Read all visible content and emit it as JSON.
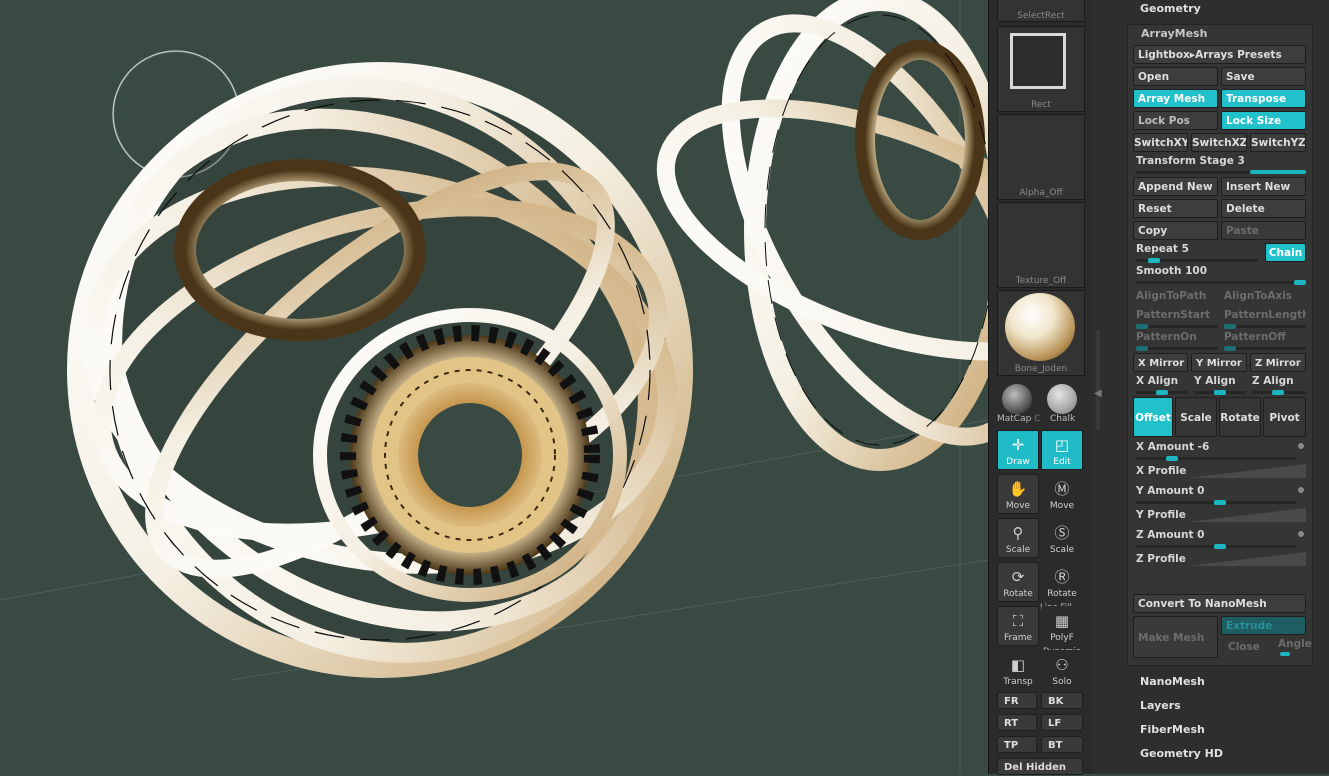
{
  "colors": {
    "accent": "#1fbcc8",
    "viewport_bg": "#394a43",
    "panel_bg": "#2e2e2e"
  },
  "shelf": {
    "top_label": "SelectRect",
    "rect_label": "Rect",
    "alpha_label": "Alpha_Off",
    "texture_label": "Texture_Off",
    "material_label": "Bone_Joden",
    "matcap_label": "MatCap",
    "matcap_suffix": "C",
    "chalk_label": "Chalk",
    "draw": "Draw",
    "edit": "Edit",
    "move1": "Move",
    "move2": "Move",
    "scale1": "Scale",
    "scale2": "Scale",
    "rotate1": "Rotate",
    "rotate2": "Rotate",
    "frame": "Frame",
    "linefill_top": "Line Fill",
    "polyf": "PolyF",
    "transp": "Transp",
    "dynamic_top": "Dynamic",
    "solo": "Solo",
    "fr": "FR",
    "bk": "BK",
    "rt": "RT",
    "lf": "LF",
    "tp": "TP",
    "bt": "BT",
    "del_hidden": "Del Hidden"
  },
  "panel": {
    "geometry": "Geometry",
    "arraymesh_title": "ArrayMesh",
    "lightbox": "Lightbox▸Arrays Presets",
    "open": "Open",
    "save": "Save",
    "array_mesh": "Array Mesh",
    "transpose": "Transpose",
    "lock_pos": "Lock Pos",
    "lock_size": "Lock Size",
    "switch_xy": "SwitchXY",
    "switch_xz": "SwitchXZ",
    "switch_yz": "SwitchYZ",
    "transform_stage": "Transform Stage 3",
    "append_new": "Append New",
    "insert_new": "Insert New",
    "reset": "Reset",
    "delete": "Delete",
    "copy": "Copy",
    "paste": "Paste",
    "repeat": "Repeat 5",
    "chain": "Chain",
    "smooth": "Smooth 100",
    "align_to_path": "AlignToPath",
    "align_to_axis": "AlignToAxis",
    "pattern_start": "PatternStart",
    "pattern_length": "PatternLength",
    "pattern_on": "PatternOn",
    "pattern_off": "PatternOff",
    "x_mirror": "X Mirror",
    "y_mirror": "Y Mirror",
    "z_mirror": "Z Mirror",
    "x_align": "X Align",
    "y_align": "Y Align",
    "z_align": "Z Align",
    "offset": "Offset",
    "scale": "Scale",
    "rotate": "Rotate",
    "pivot": "Pivot",
    "x_amount": "X Amount -6",
    "x_profile": "X Profile",
    "y_amount": "Y Amount 0",
    "y_profile": "Y Profile",
    "z_amount": "Z Amount 0",
    "z_profile": "Z Profile",
    "convert": "Convert To NanoMesh",
    "make_mesh": "Make Mesh",
    "extrude": "Extrude",
    "close": "Close",
    "angle": "Angle",
    "nanomesh": "NanoMesh",
    "layers": "Layers",
    "fibermesh": "FiberMesh",
    "geometry_hd": "Geometry HD"
  }
}
